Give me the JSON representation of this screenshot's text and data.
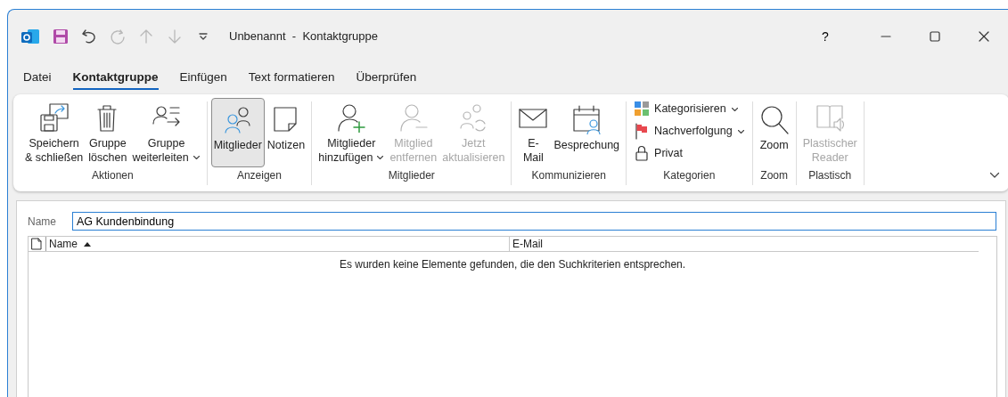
{
  "window": {
    "title": "Unbenannt  -  Kontaktgruppe",
    "help": "?"
  },
  "quick_access": [
    {
      "kind": "app"
    },
    {
      "kind": "save"
    },
    {
      "kind": "undo",
      "disabled": false
    },
    {
      "kind": "redo",
      "disabled": true
    },
    {
      "kind": "up",
      "disabled": true
    },
    {
      "kind": "down",
      "disabled": true
    },
    {
      "kind": "customize",
      "disabled": false
    }
  ],
  "tabs": [
    {
      "label": "Datei",
      "selected": false
    },
    {
      "label": "Kontaktgruppe",
      "selected": true
    },
    {
      "label": "Einfügen",
      "selected": false
    },
    {
      "label": "Text formatieren",
      "selected": false
    },
    {
      "label": "Überprüfen",
      "selected": false
    }
  ],
  "ribbon": {
    "groups": [
      {
        "label": "Aktionen",
        "stacked": false,
        "buttons": [
          {
            "kind": "save-close",
            "lines": [
              "Speichern",
              "& schließen"
            ],
            "dropdown": false,
            "disabled": false,
            "selected": false
          },
          {
            "kind": "delete",
            "lines": [
              "Gruppe",
              "löschen"
            ],
            "dropdown": false,
            "disabled": false,
            "selected": false
          },
          {
            "kind": "forward",
            "lines": [
              "Gruppe",
              "weiterleiten"
            ],
            "dropdown": true,
            "disabled": false,
            "selected": false
          }
        ]
      },
      {
        "label": "Anzeigen",
        "stacked": false,
        "buttons": [
          {
            "kind": "members",
            "lines": [
              "Mitglieder"
            ],
            "dropdown": false,
            "disabled": false,
            "selected": true
          },
          {
            "kind": "notes",
            "lines": [
              "Notizen"
            ],
            "dropdown": false,
            "disabled": false,
            "selected": false
          }
        ]
      },
      {
        "label": "Mitglieder",
        "stacked": false,
        "buttons": [
          {
            "kind": "add-member",
            "lines": [
              "Mitglieder",
              "hinzufügen"
            ],
            "dropdown": true,
            "disabled": false,
            "selected": false
          },
          {
            "kind": "remove-member",
            "lines": [
              "Mitglied",
              "entfernen"
            ],
            "dropdown": false,
            "disabled": true,
            "selected": false
          },
          {
            "kind": "refresh",
            "lines": [
              "Jetzt",
              "aktualisieren"
            ],
            "dropdown": false,
            "disabled": true,
            "selected": false
          }
        ]
      },
      {
        "label": "Kommunizieren",
        "stacked": false,
        "buttons": [
          {
            "kind": "mail",
            "lines": [
              "E-",
              "Mail"
            ],
            "dropdown": false,
            "disabled": false,
            "selected": false
          },
          {
            "kind": "meeting",
            "lines": [
              "Besprechung"
            ],
            "dropdown": false,
            "disabled": false,
            "selected": false
          }
        ]
      },
      {
        "label": "Kategorien",
        "stacked": true,
        "buttons": [
          {
            "kind": "categorize",
            "lines": [
              "Kategorisieren"
            ],
            "dropdown": true,
            "disabled": false
          },
          {
            "kind": "follow-up",
            "lines": [
              "Nachverfolgung"
            ],
            "dropdown": true,
            "disabled": false
          },
          {
            "kind": "private",
            "lines": [
              "Privat"
            ],
            "dropdown": false,
            "disabled": false
          }
        ]
      },
      {
        "label": "Zoom",
        "stacked": false,
        "buttons": [
          {
            "kind": "zoom",
            "lines": [
              "Zoom"
            ],
            "dropdown": false,
            "disabled": false,
            "selected": false
          }
        ]
      },
      {
        "label": "Plastisch",
        "stacked": false,
        "buttons": [
          {
            "kind": "reader",
            "lines": [
              "Plastischer",
              "Reader"
            ],
            "dropdown": false,
            "disabled": true,
            "selected": false
          }
        ]
      }
    ]
  },
  "form": {
    "name_label": "Name",
    "name_value": "AG Kundenbindung"
  },
  "members_table": {
    "columns": [
      {
        "label": "Name",
        "sorted": true
      },
      {
        "label": "E-Mail",
        "sorted": false
      }
    ],
    "empty_message": "Es wurden keine Elemente gefunden, die den Suchkriterien entsprechen."
  }
}
